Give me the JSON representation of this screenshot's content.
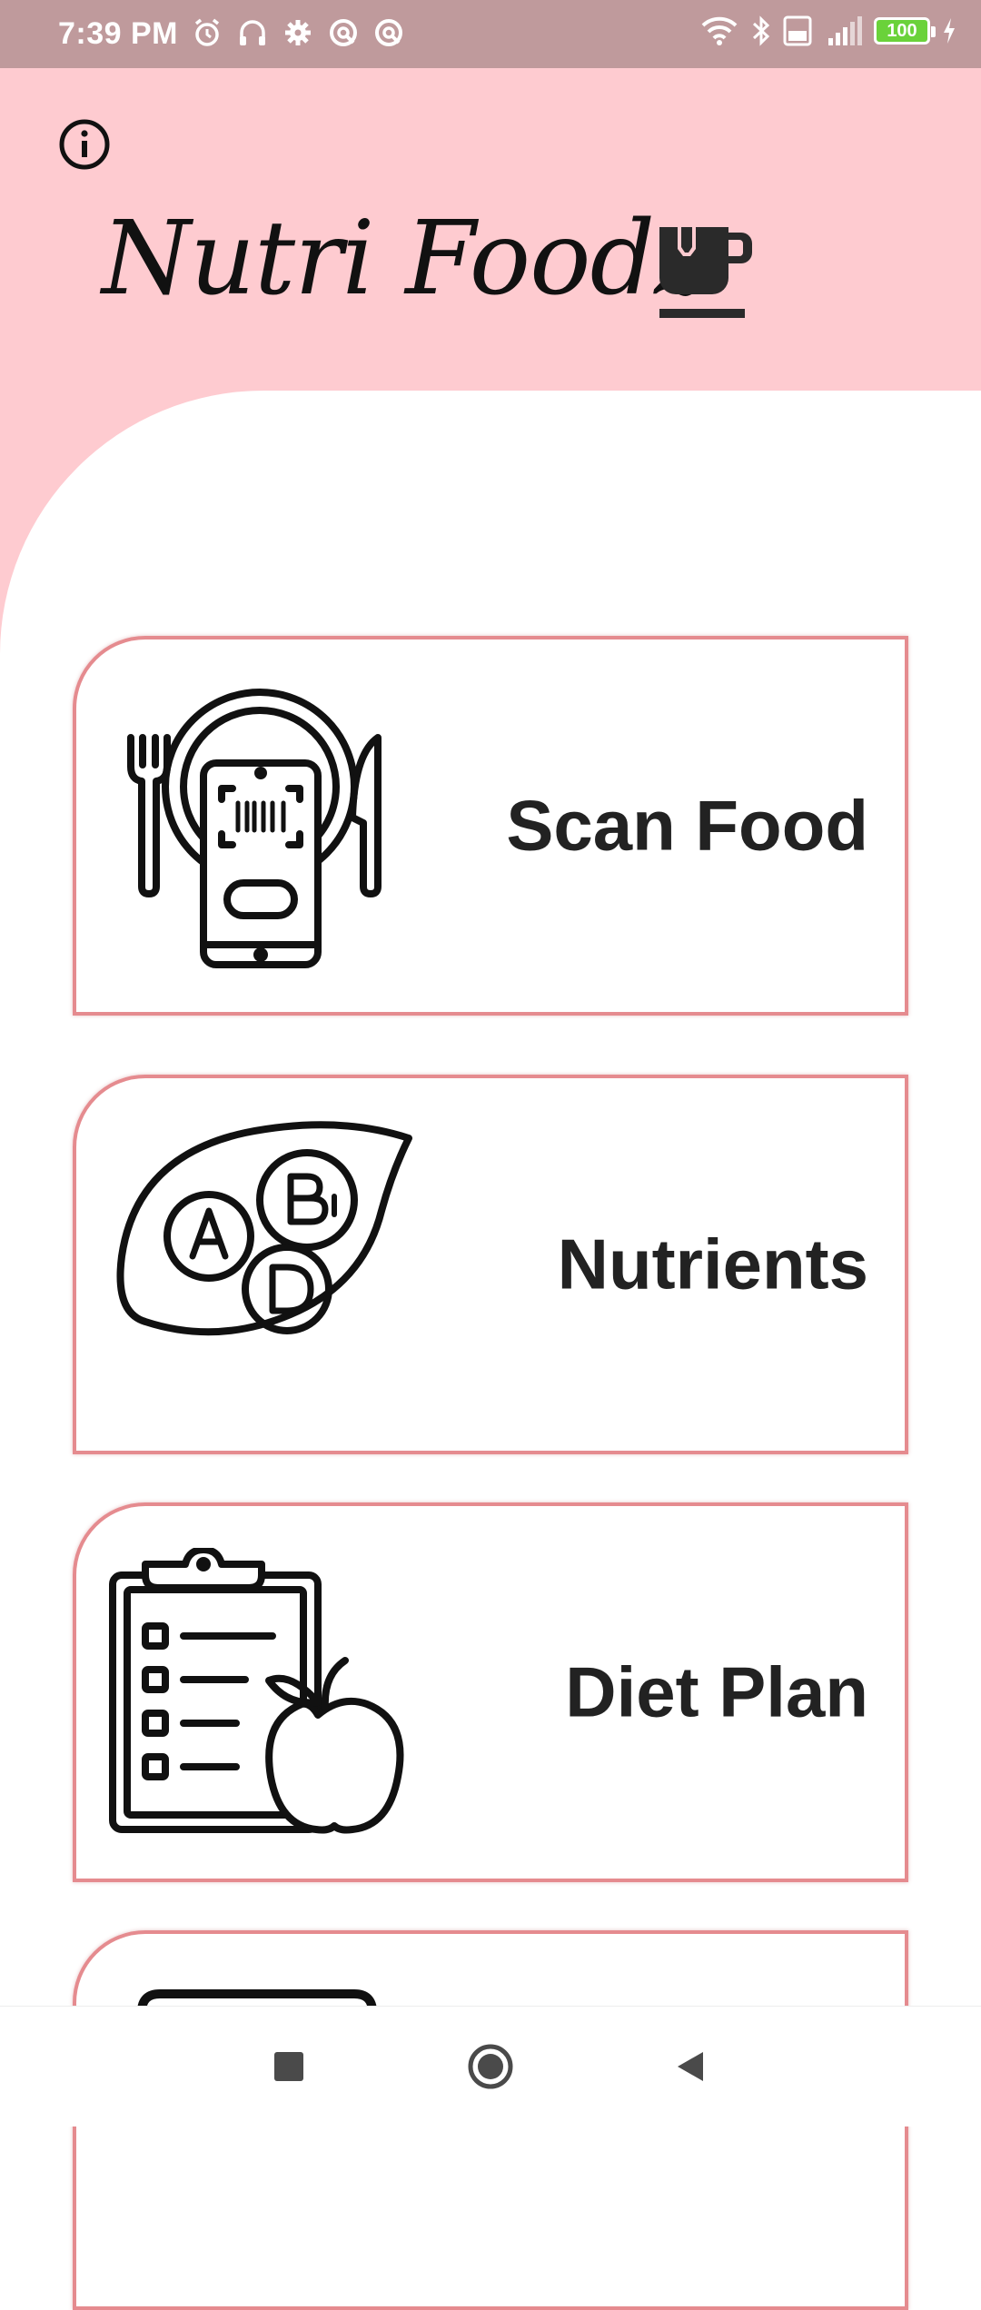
{
  "status_bar": {
    "time": "7:39 PM",
    "battery": "100",
    "icons_left": [
      "alarm-icon",
      "headphones-icon",
      "settings-gear-icon",
      "app-notification-icon",
      "app-notification-icon"
    ],
    "icons_right": [
      "wifi-icon",
      "bluetooth-icon",
      "volte-icon",
      "signal-4g-icon",
      "battery-icon",
      "charging-icon"
    ],
    "colors": {
      "background": "#bf9a9c"
    }
  },
  "header": {
    "title": "Nutri Foodz",
    "info_icon": "info-icon",
    "logo_icon": "coffee-cup-icon",
    "colors": {
      "background": "#fecbd0"
    }
  },
  "menu": {
    "items": [
      {
        "label": "Scan Food",
        "icon": "scan-food-phone-plate-icon"
      },
      {
        "label": "Nutrients",
        "icon": "vitamins-leaf-icon"
      },
      {
        "label": "Diet Plan",
        "icon": "clipboard-apple-icon"
      },
      {
        "label": "",
        "icon": "partial-card-icon"
      }
    ],
    "colors": {
      "border": "#e58b8f",
      "text": "#222222"
    }
  },
  "nav_bar": {
    "buttons": [
      "recents-square-icon",
      "home-circle-icon",
      "back-triangle-icon"
    ]
  }
}
